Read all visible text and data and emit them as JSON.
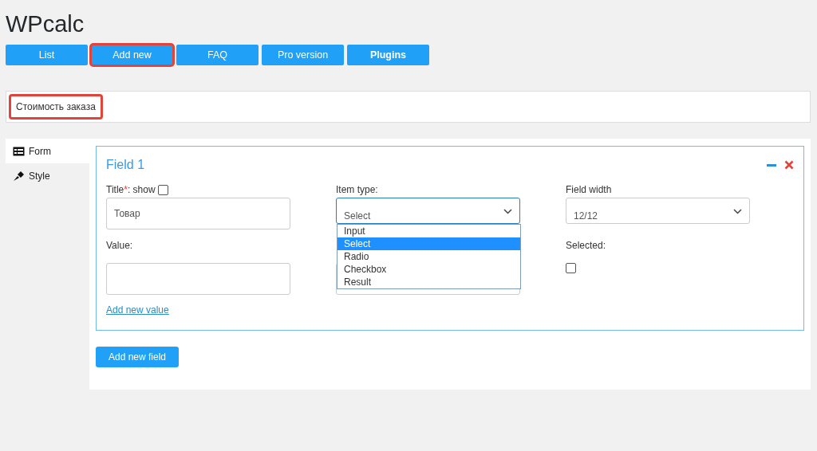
{
  "page_title": "WPcalc",
  "nav": [
    {
      "label": "List",
      "bold": false,
      "highlighted": false
    },
    {
      "label": "Add new",
      "bold": false,
      "highlighted": true
    },
    {
      "label": "FAQ",
      "bold": false,
      "highlighted": false
    },
    {
      "label": "Pro version",
      "bold": false,
      "highlighted": false
    },
    {
      "label": "Plugins",
      "bold": true,
      "highlighted": false
    }
  ],
  "calc_name": {
    "value": "Стоимость заказа",
    "highlighted": true
  },
  "tabs": [
    {
      "label": "Form",
      "kind": "form",
      "selected": true
    },
    {
      "label": "Style",
      "kind": "style",
      "selected": false
    }
  ],
  "field": {
    "title": "Field 1",
    "title_label": "Title",
    "required_mark": "*",
    "show_label": ": show",
    "show_checked": false,
    "title_value": "Товар",
    "value_label": "Value:",
    "add_value_link": "Add new value",
    "item_type_label": "Item type:",
    "item_type_value": "Select",
    "item_type_options": [
      {
        "label": "Input",
        "selected": false
      },
      {
        "label": "Select",
        "selected": true
      },
      {
        "label": "Radio",
        "selected": false
      },
      {
        "label": "Checkbox",
        "selected": false
      },
      {
        "label": "Result",
        "selected": false
      }
    ],
    "width_label": "Field width",
    "width_value": "12/12",
    "selected_label": "Selected:",
    "selected_checked": false
  },
  "add_field_button": "Add new field"
}
